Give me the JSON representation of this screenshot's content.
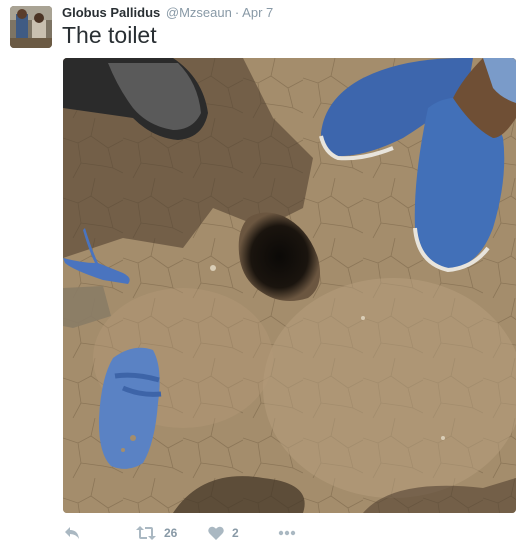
{
  "tweet": {
    "display_name": "Globus Pallidus",
    "handle": "@Mzseaun",
    "separator": "·",
    "date": "Apr 7",
    "text": "The toilet"
  },
  "photo": {
    "description_icon": "photo-image"
  },
  "actions": {
    "reply_icon": "reply-icon",
    "retweet_icon": "retweet-icon",
    "retweet_count": "26",
    "like_icon": "heart-icon",
    "like_count": "2",
    "more_icon": "more-icon"
  },
  "colors": {
    "text": "#292f33",
    "muted": "#8899a6",
    "icon": "#aab8c2"
  }
}
